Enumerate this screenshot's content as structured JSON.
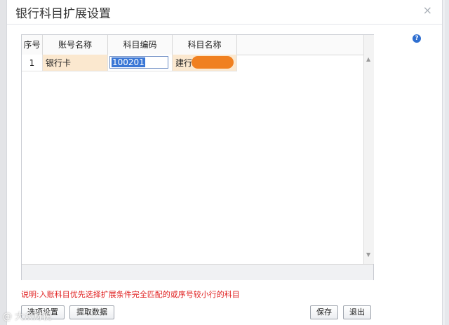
{
  "dialog": {
    "title": "银行科目扩展设置",
    "close_glyph": "×",
    "help_glyph": "?"
  },
  "grid": {
    "columns": [
      "序号",
      "账号名称",
      "科目编码",
      "科目名称"
    ],
    "rows": [
      {
        "seq": "1",
        "account_name": "银行卡",
        "subject_code": "100201",
        "subject_name": "建行"
      }
    ]
  },
  "note": "说明:入账科目优先选择扩展条件完全匹配的或序号较小行的科目",
  "buttons": {
    "options": "选项设置",
    "fetch": "提取数据",
    "save": "保存",
    "exit": "退出"
  },
  "watermark": "@ 大众财税",
  "colors": {
    "note_red": "#e02020",
    "highlight_row": "#fbe8cf",
    "redaction": "#f08020",
    "selection_blue": "#3a77d6"
  }
}
